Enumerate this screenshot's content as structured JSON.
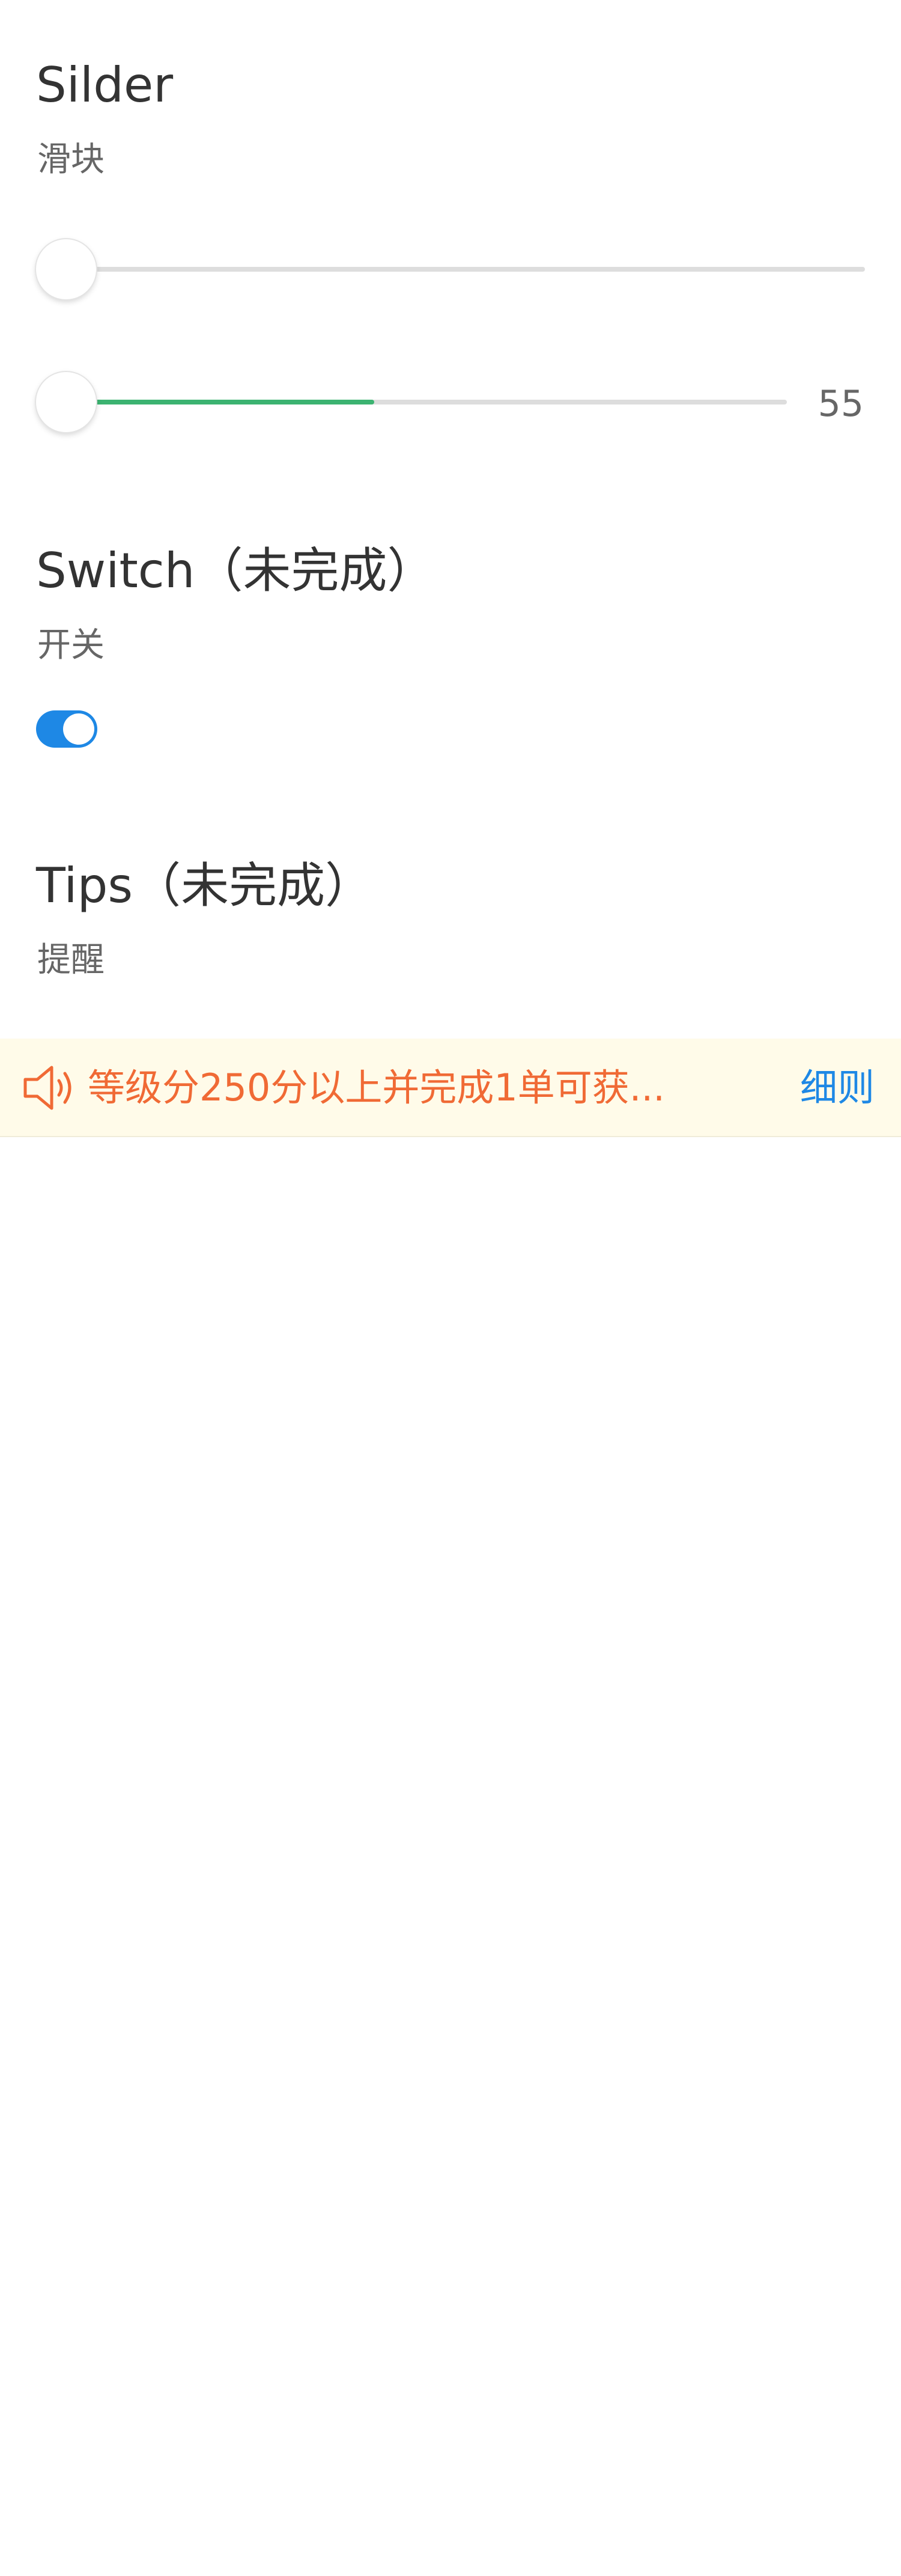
{
  "slider_section": {
    "title": "Silder",
    "subtitle": "滑块",
    "slider1": {
      "value_fraction": 0.0
    },
    "slider2": {
      "value": "55",
      "fill_fraction": 0.45
    }
  },
  "switch_section": {
    "title": "Switch（未完成）",
    "subtitle": "开关",
    "switch": {
      "on": true
    }
  },
  "tips_section": {
    "title": "Tips（未完成）",
    "subtitle": "提醒",
    "tips_bar": {
      "icon": "speaker-icon",
      "message": "等级分250分以上并完成1单可获...",
      "link_label": "细则"
    }
  },
  "colors": {
    "accent_blue": "#1e88e5",
    "slider_fill_green": "#3cb371",
    "tips_text_orange": "#f06a35",
    "tips_background": "#fffbe9"
  }
}
